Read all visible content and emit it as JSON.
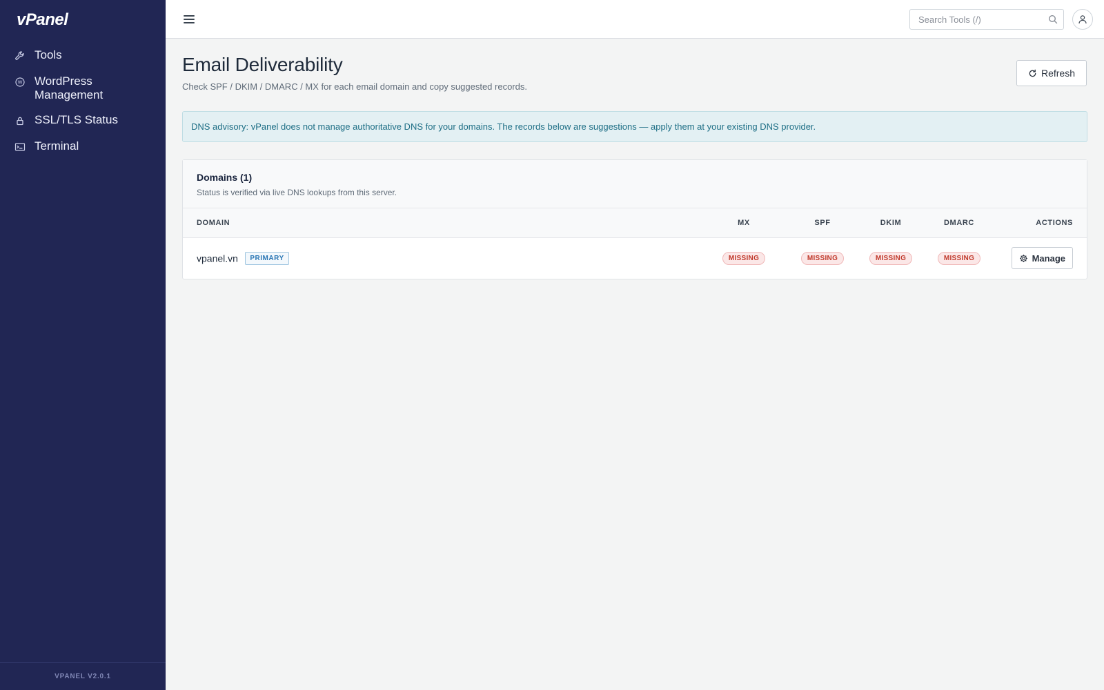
{
  "app": {
    "logo_text": "vPanel",
    "version": "VPANEL V2.0.1"
  },
  "sidebar": {
    "items": [
      {
        "label": "Tools",
        "icon": "wrench-icon"
      },
      {
        "label": "WordPress Management",
        "icon": "wordpress-icon"
      },
      {
        "label": "SSL/TLS Status",
        "icon": "lock-icon"
      },
      {
        "label": "Terminal",
        "icon": "terminal-icon"
      }
    ]
  },
  "topbar": {
    "search_placeholder": "Search Tools (/)"
  },
  "page": {
    "title": "Email Deliverability",
    "subtitle": "Check SPF / DKIM / DMARC / MX for each email domain and copy suggested records.",
    "refresh_label": "Refresh",
    "advisory": "DNS advisory: vPanel does not manage authoritative DNS for your domains. The records below are suggestions — apply them at your existing DNS provider."
  },
  "domains_card": {
    "title": "Domains (1)",
    "description": "Status is verified via live DNS lookups from this server.",
    "columns": {
      "domain": "DOMAIN",
      "mx": "MX",
      "spf": "SPF",
      "dkim": "DKIM",
      "dmarc": "DMARC",
      "actions": "ACTIONS"
    },
    "rows": [
      {
        "domain": "vpanel.vn",
        "badge": "PRIMARY",
        "mx": "MISSING",
        "spf": "MISSING",
        "dkim": "MISSING",
        "dmarc": "MISSING",
        "action_label": "Manage"
      }
    ]
  },
  "colors": {
    "sidebar_bg": "#212654",
    "missing": "#c0392b",
    "advisory_text": "#1d6e85",
    "primary_badge": "#2b77b5"
  }
}
